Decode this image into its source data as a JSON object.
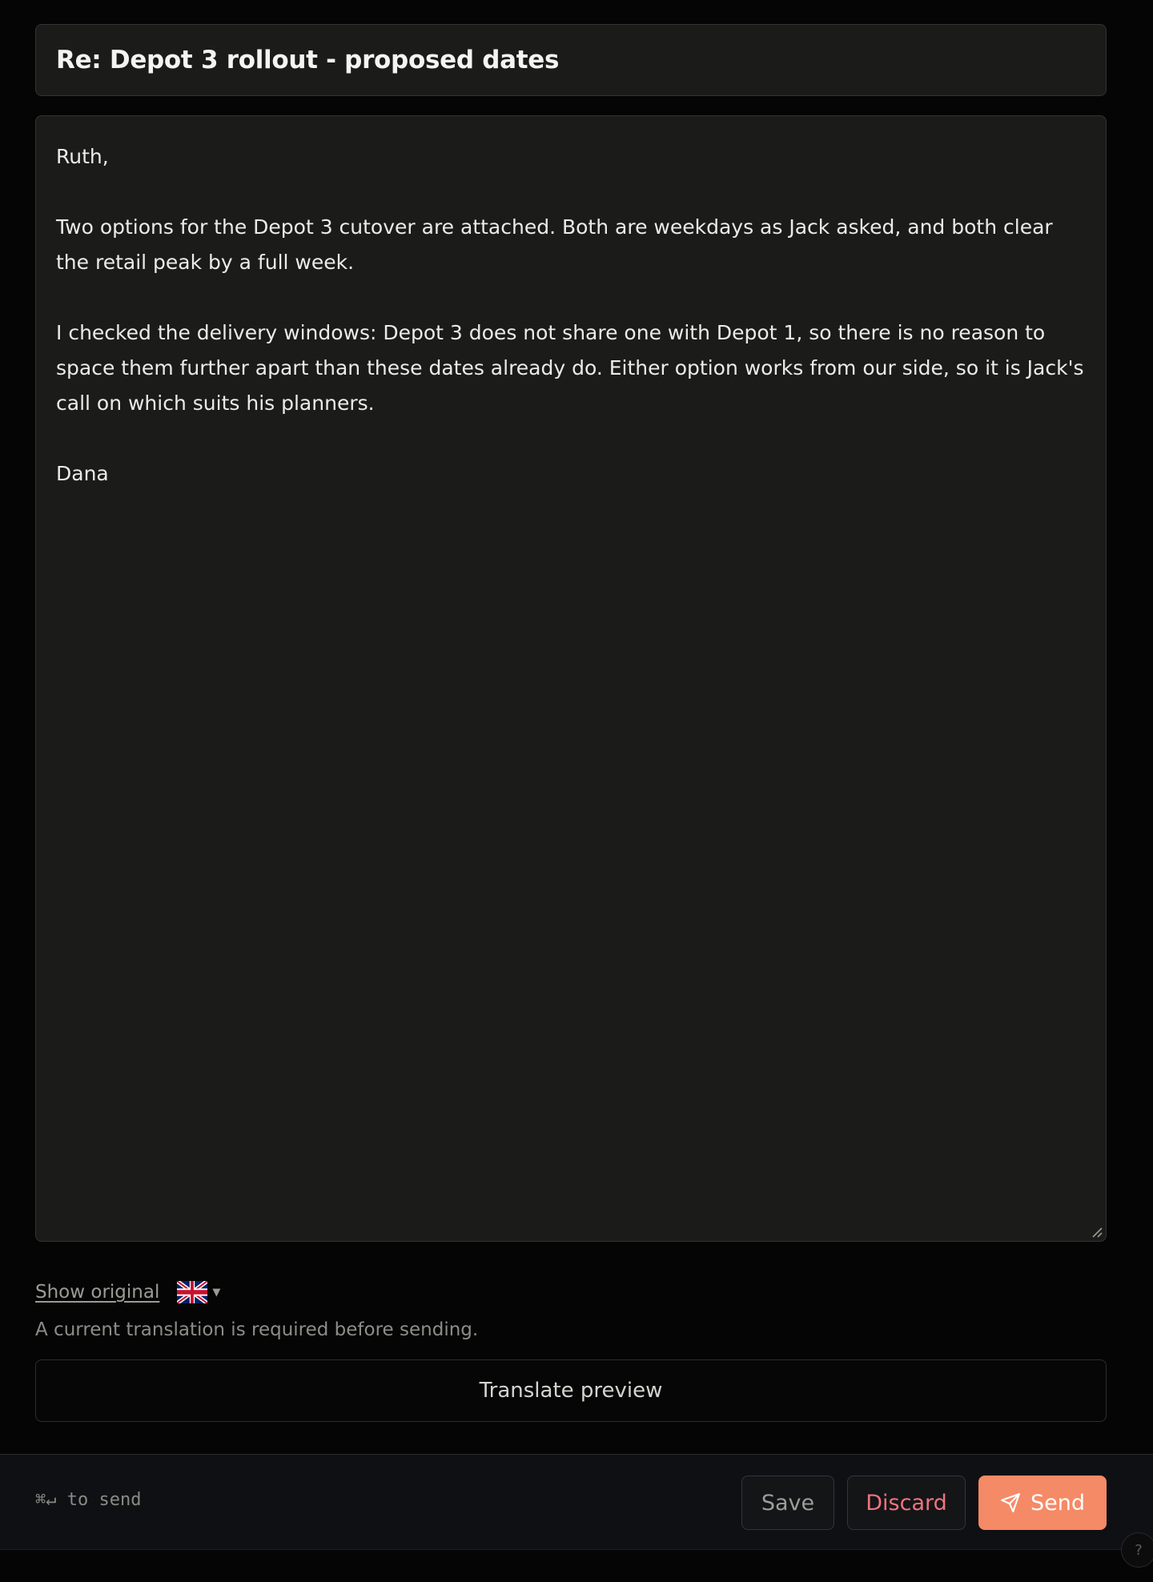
{
  "subject": "Re: Depot 3 rollout - proposed dates",
  "body": {
    "paragraphs": [
      "Ruth,",
      "Two options for the Depot 3 cutover are attached. Both are weekdays as Jack asked, and both clear the retail peak by a full week.",
      "I checked the delivery windows: Depot 3 does not share one with Depot 1, so there is no reason to space them further apart than these dates already do. Either option works from our side, so it is Jack's call on which suits his planners.",
      "Dana"
    ]
  },
  "translation": {
    "show_original_label": "Show original",
    "language_flag_icon": "uk-flag-icon",
    "hint": "A current translation is required before sending.",
    "preview_button_label": "Translate preview"
  },
  "footer": {
    "shortcut_hint": "⌘↵ to send",
    "save_label": "Save",
    "discard_label": "Discard",
    "send_label": "Send",
    "send_icon": "paper-plane-icon"
  },
  "help": {
    "label": "?"
  },
  "colors": {
    "accent": "#f58a66",
    "danger": "#f0747f",
    "surface": "#1b1b1a",
    "background": "#050505"
  }
}
